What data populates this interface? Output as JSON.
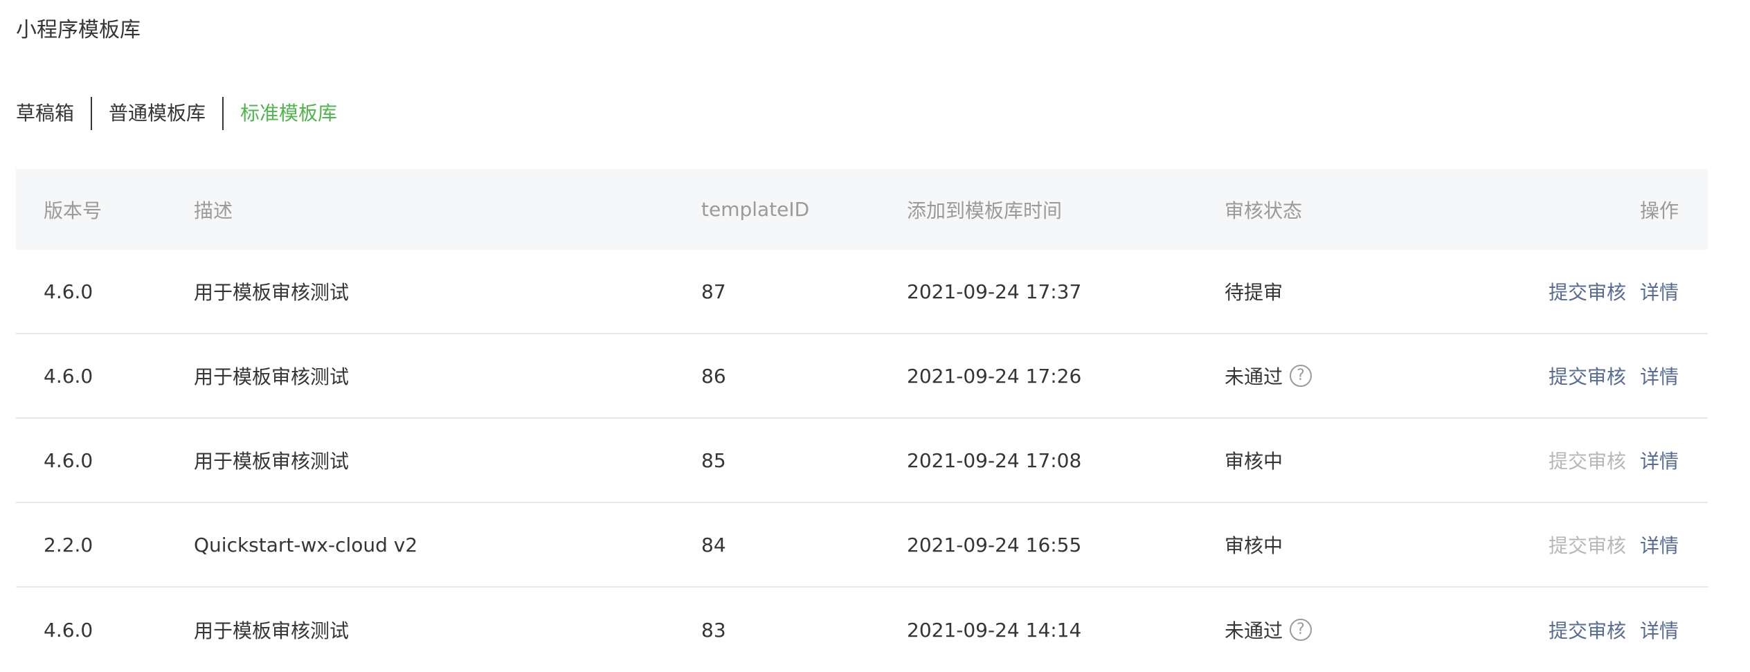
{
  "page": {
    "title": "小程序模板库"
  },
  "tabs": [
    {
      "label": "草稿箱",
      "active": false
    },
    {
      "label": "普通模板库",
      "active": false
    },
    {
      "label": "标准模板库",
      "active": true
    }
  ],
  "colors": {
    "active_tab": "#4fb54c",
    "link": "#576b95",
    "disabled_link": "#b7b7b7",
    "header_bg": "#f6f7f9",
    "header_text": "#9a9a9a"
  },
  "table": {
    "headers": {
      "version": "版本号",
      "desc": "描述",
      "template_id": "templateID",
      "time": "添加到模板库时间",
      "status": "审核状态",
      "ops": "操作"
    },
    "rows": [
      {
        "version": "4.6.0",
        "desc": "用于模板审核测试",
        "template_id": "87",
        "time": "2021-09-24 17:37",
        "status": "待提审",
        "has_help": false,
        "submit_label": "提交审核",
        "submit_enabled": true,
        "detail_label": "详情"
      },
      {
        "version": "4.6.0",
        "desc": "用于模板审核测试",
        "template_id": "86",
        "time": "2021-09-24 17:26",
        "status": "未通过",
        "has_help": true,
        "help_icon": "?",
        "submit_label": "提交审核",
        "submit_enabled": true,
        "detail_label": "详情"
      },
      {
        "version": "4.6.0",
        "desc": "用于模板审核测试",
        "template_id": "85",
        "time": "2021-09-24 17:08",
        "status": "审核中",
        "has_help": false,
        "submit_label": "提交审核",
        "submit_enabled": false,
        "detail_label": "详情"
      },
      {
        "version": "2.2.0",
        "desc": "Quickstart-wx-cloud v2",
        "template_id": "84",
        "time": "2021-09-24 16:55",
        "status": "审核中",
        "has_help": false,
        "submit_label": "提交审核",
        "submit_enabled": false,
        "detail_label": "详情"
      },
      {
        "version": "4.6.0",
        "desc": "用于模板审核测试",
        "template_id": "83",
        "time": "2021-09-24 14:14",
        "status": "未通过",
        "has_help": true,
        "help_icon": "?",
        "submit_label": "提交审核",
        "submit_enabled": true,
        "detail_label": "详情"
      }
    ]
  }
}
